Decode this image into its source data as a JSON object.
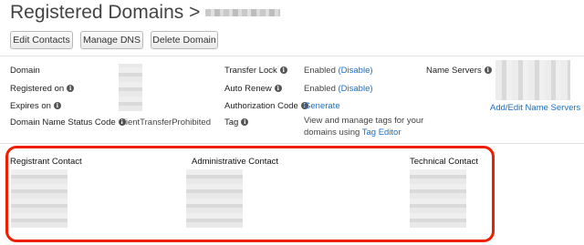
{
  "header": {
    "title": "Registered Domains >"
  },
  "toolbar": {
    "edit_contacts": "Edit Contacts",
    "manage_dns": "Manage DNS",
    "delete_domain": "Delete Domain"
  },
  "details": {
    "domain_label": "Domain",
    "registered_on_label": "Registered on",
    "expires_on_label": "Expires on",
    "status_code_label": "Domain Name Status Code",
    "status_code_value": "clientTransferProhibited",
    "transfer_lock_label": "Transfer Lock",
    "transfer_lock_value": "Enabled",
    "transfer_lock_action": "(Disable)",
    "auto_renew_label": "Auto Renew",
    "auto_renew_value": "Enabled",
    "auto_renew_action": "(Disable)",
    "auth_code_label": "Authorization Code",
    "auth_code_action": "Generate",
    "tag_label": "Tag",
    "tag_text_1": "View and manage tags for your",
    "tag_text_2": "domains using",
    "tag_editor_link": "Tag Editor",
    "name_servers_label": "Name Servers",
    "name_servers_link": "Add/Edit Name Servers"
  },
  "contacts": {
    "registrant": "Registrant Contact",
    "administrative": "Administrative Contact",
    "technical": "Technical Contact"
  },
  "colors": {
    "link": "#1a6fc4",
    "highlight": "#f01e00"
  }
}
